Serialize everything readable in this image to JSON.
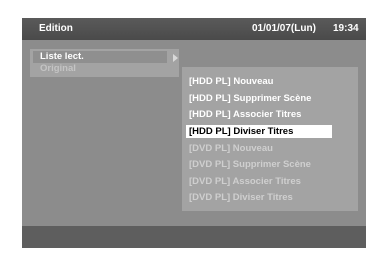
{
  "header": {
    "title": "Edition",
    "date": "01/01/07(Lun)",
    "time": "19:34"
  },
  "menu": {
    "items": [
      {
        "label": "Liste lect."
      },
      {
        "label": "Original"
      }
    ],
    "expand_icon": "triangle-right-icon"
  },
  "submenu": {
    "items": [
      {
        "label": "[HDD PL] Nouveau"
      },
      {
        "label": "[HDD PL] Supprimer Scène"
      },
      {
        "label": "[HDD PL] Associer Titres"
      },
      {
        "label": "[HDD PL] Diviser Titres"
      },
      {
        "label": "[DVD PL] Nouveau"
      },
      {
        "label": "[DVD PL] Supprimer Scène"
      },
      {
        "label": "[DVD PL] Associer Titres"
      },
      {
        "label": "[DVD PL] Diviser Titres"
      }
    ]
  },
  "colors": {
    "screen_bg": "#8c8c8c",
    "title_bar": "#4f4f4f",
    "panel": "#a3a3a3",
    "highlight": "#ffffff"
  }
}
